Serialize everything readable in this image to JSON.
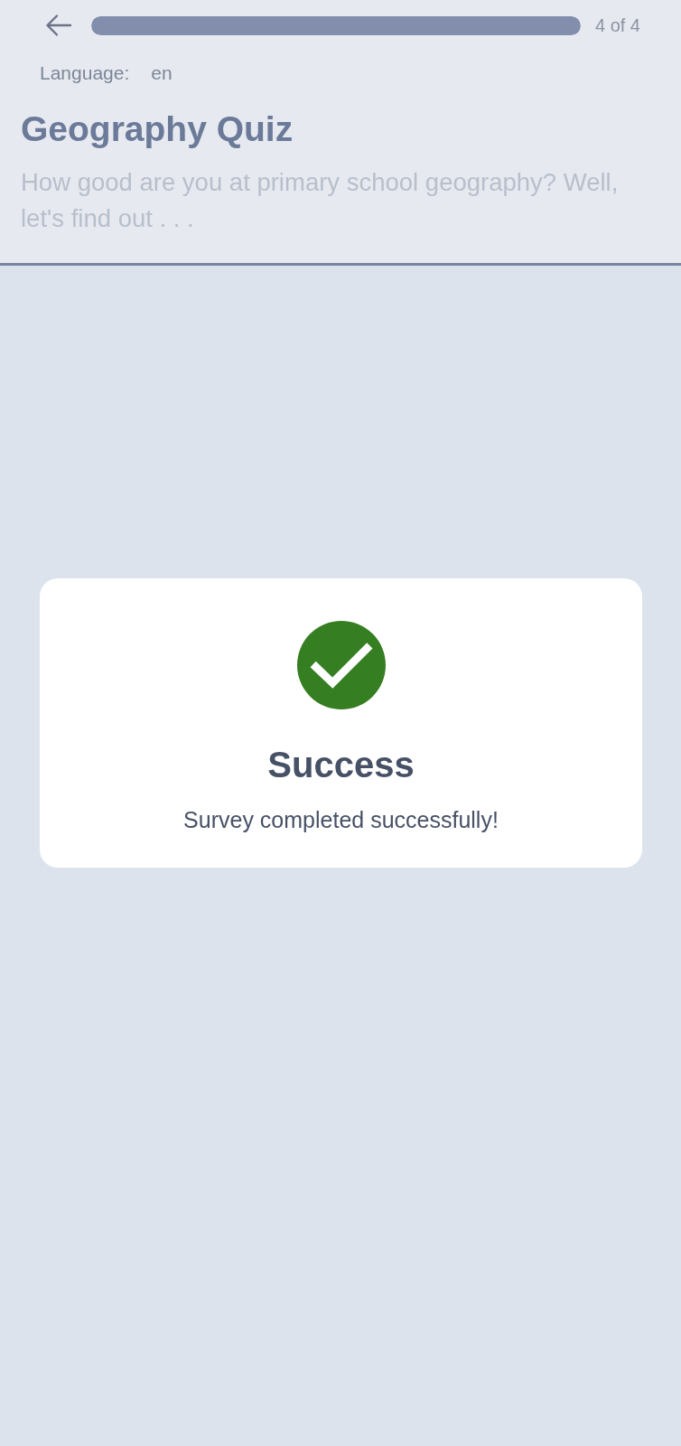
{
  "header": {
    "progress": {
      "level": 1,
      "label": "4 of 4"
    },
    "language": {
      "label": "Language:",
      "value": "en"
    },
    "title": "Geography Quiz",
    "description": "How good are you at primary school geography? Well, let's find out . . ."
  },
  "dialog": {
    "kind": "success",
    "title": "Success",
    "message": "Survey completed successfully!"
  }
}
